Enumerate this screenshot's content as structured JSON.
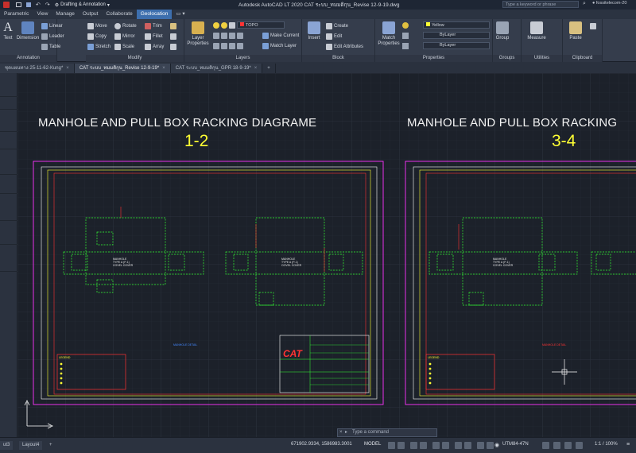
{
  "titlebar": {
    "workspace": "Drafting & Annotation",
    "app_title": "Autodesk AutoCAD LT 2020   CAT ระบบ_ทมมติกุน_Revise 12-9-19.dwg",
    "search_placeholder": "Type a keyword or phrase",
    "user": "fossitelecom-20"
  },
  "ribbon_tabs": [
    "Parametric",
    "View",
    "Manage",
    "Output",
    "Collaborate",
    "Geolocation"
  ],
  "ribbon_active_tab": "Geolocation",
  "annotation": {
    "text": "Text",
    "dimension": "Dimension",
    "linear": "Linear",
    "leader": "Leader",
    "table": "Table",
    "label": "Annotation"
  },
  "modify": {
    "move": "Move",
    "rotate": "Rotate",
    "trim": "Trim",
    "copy": "Copy",
    "mirror": "Mirror",
    "fillet": "Fillet",
    "stretch": "Stretch",
    "scale": "Scale",
    "array": "Array",
    "label": "Modify"
  },
  "layers": {
    "layer_properties": "Layer Properties",
    "current_layer": "TOPO",
    "make_current": "Make Current",
    "match_layer": "Match Layer",
    "label": "Layers"
  },
  "block": {
    "insert": "Insert",
    "create": "Create",
    "edit": "Edit",
    "edit_attributes": "Edit Attributes",
    "label": "Block"
  },
  "properties": {
    "match": "Match Properties",
    "color": "Yellow",
    "linetype": "ByLayer",
    "lineweight": "ByLayer",
    "label": "Properties"
  },
  "groups": {
    "group": "Group",
    "label": "Groups"
  },
  "utilities": {
    "measure": "Measure",
    "label": "Utilities"
  },
  "clipboard": {
    "paste": "Paste",
    "label": "Clipboard"
  },
  "doc_tabs": [
    {
      "label": "ชุดแผนทาง 25-11-62-Kung*",
      "active": false
    },
    {
      "label": "CAT ระบบ_ทมมติกุน_Revise 12-9-19*",
      "active": true
    },
    {
      "label": "CAT ระบบ_ทมมติกุน_GPR 18-9-19*",
      "active": false
    }
  ],
  "drawing": {
    "sheet1_title": "MANHOLE AND PULL BOX RACKING DIAGRAME",
    "sheet1_number": "1-2",
    "sheet2_title": "MANHOLE AND PULL BOX RACKING",
    "sheet2_number": "3-4",
    "manhole_label_1": "MANHOLE",
    "manhole_label_2": "TYPE A (P-1)",
    "manhole_label_3": "COVEL COVER",
    "legend_title": "LEGEND",
    "logo": "CAT",
    "detail_label": "MANHOLE DETAIL"
  },
  "status": {
    "layout_tab_1": "ut3",
    "layout_tab_2": "Layout4",
    "add_tab": "+",
    "coords": "671902.9334, 1586983.3001",
    "model": "MODEL",
    "command_placeholder": "Type a command",
    "utm": "UTM84-47N",
    "scale": "1:1 / 100%"
  },
  "colors": {
    "accent": "#3d6fae",
    "green_lines": "#33ff33",
    "red_lines": "#ff3333",
    "yellow_text": "#ffff33",
    "magenta_frame": "#ff33ff"
  }
}
